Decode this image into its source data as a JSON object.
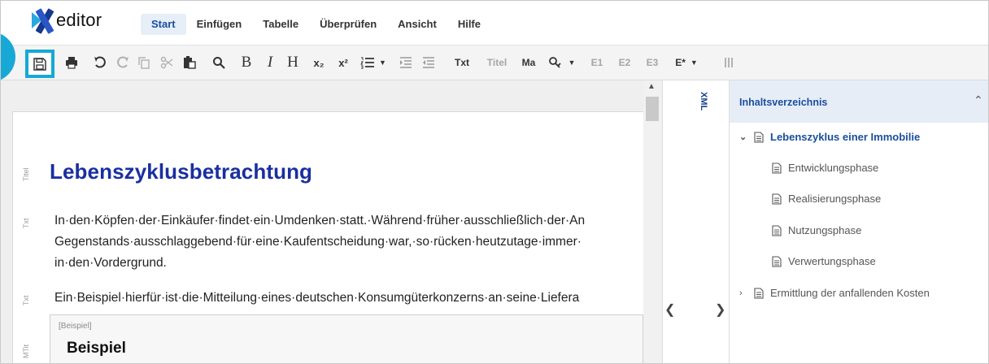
{
  "app": {
    "logo_text": "editor"
  },
  "menu": [
    "Start",
    "Einfügen",
    "Tabelle",
    "Überprüfen",
    "Ansicht",
    "Hilfe"
  ],
  "toolbar": {
    "txt": "Txt",
    "titel": "Titel",
    "ma": "Ma",
    "e1": "E1",
    "e2": "E2",
    "e3": "E3",
    "e_star": "E*",
    "sub": "x₂",
    "sup": "x²",
    "bold": "B",
    "italic": "I",
    "heading": "H"
  },
  "editor": {
    "labels": {
      "titel": "Titel",
      "txt1": "Txt",
      "txt2": "Txt",
      "mtit": "MTit"
    },
    "title": "Lebenszyklusbetrachtung",
    "para1_line1": "In·den·Köpfen·der·Einkäufer·findet·ein·Umdenken·statt.·Während·früher·ausschließlich·der·An",
    "para1_line2": "Gegenstands·ausschlaggebend·für·eine·Kaufentscheidung·war,·so·rücken·heutzutage·immer·",
    "para1_line3": "in·den·Vordergrund.",
    "para2_line1": "Ein·Beispiel·hierfür·ist·die·Mitteilung·eines·deutschen·Konsumgüterkonzerns·an·seine·Liefera",
    "example_tag": "[Beispiel]",
    "example_title": "Beispiel"
  },
  "xml_panel": {
    "label": "XML"
  },
  "toc": {
    "header": "Inhaltsverzeichnis",
    "items": [
      {
        "label": "Lebenszyklus einer Immobilie"
      },
      {
        "label": "Entwicklungsphase"
      },
      {
        "label": "Realisierungsphase"
      },
      {
        "label": "Nutzungsphase"
      },
      {
        "label": "Verwertungsphase"
      },
      {
        "label": "Ermittlung der anfallenden Kosten"
      }
    ]
  },
  "colors": {
    "accent": "#16a9d4",
    "brand": "#1a2fa0",
    "toc_active": "#1a4e9d"
  }
}
